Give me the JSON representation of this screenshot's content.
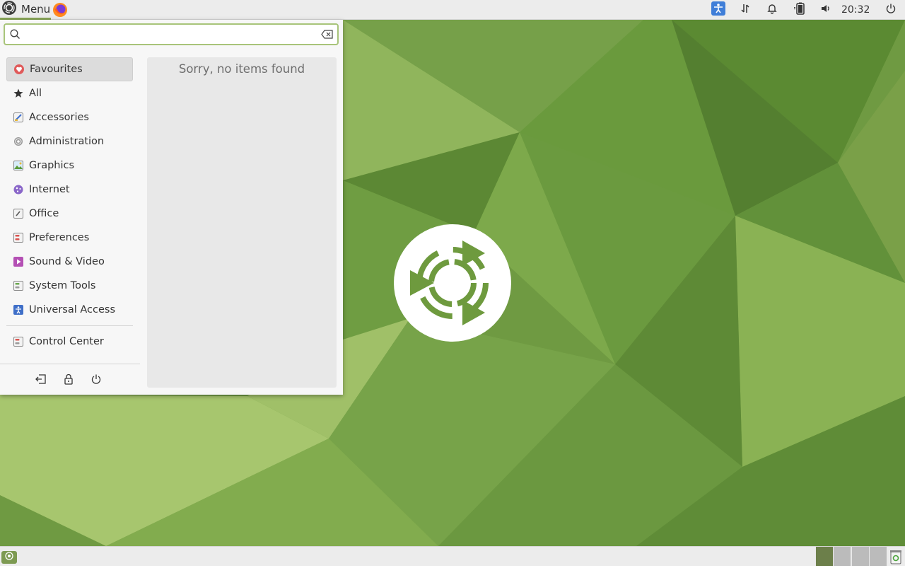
{
  "top_panel": {
    "menu_label": "Menu",
    "clock": "20:32",
    "tray_icons": [
      "accessibility-icon",
      "network-transfer-icon",
      "notification-bell-icon",
      "battery-icon",
      "volume-icon",
      "power-icon"
    ]
  },
  "menu": {
    "search": {
      "value": "",
      "placeholder": ""
    },
    "categories": [
      {
        "label": "Favourites",
        "icon": "heart-icon",
        "selected": true
      },
      {
        "label": "All",
        "icon": "star-icon"
      },
      {
        "label": "Accessories",
        "icon": "accessories-icon"
      },
      {
        "label": "Administration",
        "icon": "administration-icon"
      },
      {
        "label": "Graphics",
        "icon": "graphics-icon"
      },
      {
        "label": "Internet",
        "icon": "internet-icon"
      },
      {
        "label": "Office",
        "icon": "office-icon"
      },
      {
        "label": "Preferences",
        "icon": "preferences-icon"
      },
      {
        "label": "Sound & Video",
        "icon": "sound-video-icon"
      },
      {
        "label": "System Tools",
        "icon": "system-tools-icon"
      },
      {
        "label": "Universal Access",
        "icon": "universal-access-icon"
      }
    ],
    "control_center": "Control Center",
    "empty_message": "Sorry, no items found",
    "session_buttons": [
      "log-out-icon",
      "lock-icon",
      "shutdown-icon"
    ]
  },
  "colors": {
    "accent": "#87a556",
    "panel": "#ececec",
    "wallpaper_base": "#6e9a3e"
  }
}
